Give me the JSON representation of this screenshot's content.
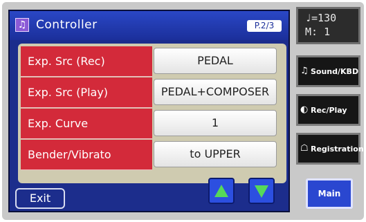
{
  "screen": {
    "title": "Controller",
    "title_icon": "music-note-icon",
    "page_indicator": "P.2/3"
  },
  "params": [
    {
      "label": "Exp. Src (Rec)",
      "value": "PEDAL"
    },
    {
      "label": "Exp. Src (Play)",
      "value": "PEDAL+COMPOSER"
    },
    {
      "label": "Exp. Curve",
      "value": "1"
    },
    {
      "label": "Bender/Vibrato",
      "value": "to UPPER"
    }
  ],
  "footer": {
    "exit_label": "Exit",
    "up_icon": "arrow-up-icon",
    "down_icon": "arrow-down-icon"
  },
  "display": {
    "tempo": "♩=130",
    "measure": "M:   1"
  },
  "side_buttons": {
    "sound_kbd": "Sound/KBD",
    "rec_play": "Rec/Play",
    "registration": "Registration",
    "main": "Main"
  },
  "colors": {
    "screen_bg": "#1c2d8c",
    "label_red": "#d32a3a",
    "arrow_green": "#56d85a"
  }
}
